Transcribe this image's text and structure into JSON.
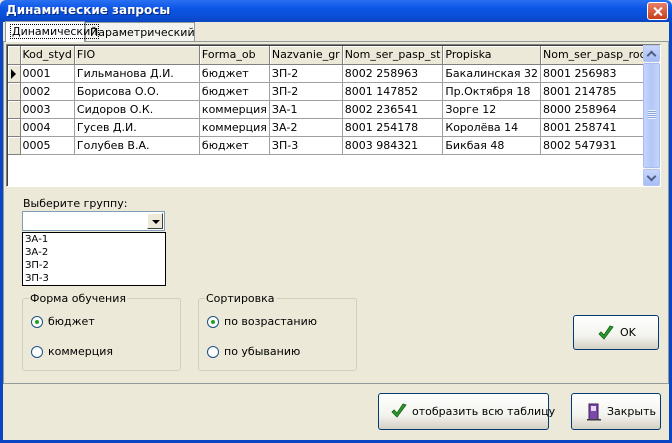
{
  "window": {
    "title": "Динамические запросы"
  },
  "tabs": [
    {
      "label": "Динамический",
      "active": true
    },
    {
      "label": "Параметрический",
      "active": false
    }
  ],
  "grid": {
    "columns": [
      "Kod_styd",
      "FIO",
      "Forma_ob",
      "Nazvanie_gr",
      "Nom_ser_pasp_st",
      "Propiska",
      "Nom_ser_pasp_rod"
    ],
    "rows": [
      [
        "0001",
        "Гильманова Д.И.",
        "бюджет",
        "ЗП-2",
        "8002 258963",
        "Бакалинская 32",
        "8001 256983"
      ],
      [
        "0002",
        "Борисова О.О.",
        "бюджет",
        "ЗП-2",
        "8001 147852",
        "Пр.Октября 18",
        "8001 214785"
      ],
      [
        "0003",
        "Сидоров О.К.",
        "коммерция",
        "ЗА-1",
        "8002 236541",
        "Зорге 12",
        "8000 258964"
      ],
      [
        "0004",
        "Гусев Д.И.",
        "коммерция",
        "ЗА-2",
        "8001 254178",
        "Королёва 14",
        "8001 258741"
      ],
      [
        "0005",
        "Голубев В.А.",
        "бюджет",
        "ЗП-3",
        "8003 984321",
        "Бикбая 48",
        "8002 547931"
      ]
    ],
    "current_row": 0
  },
  "group_select": {
    "label": "Выберите группу:",
    "value": "",
    "options": [
      "ЗА-1",
      "ЗА-2",
      "ЗП-2",
      "ЗП-3"
    ]
  },
  "form_group": {
    "title": "Форма обучения",
    "options": [
      {
        "label": "бюджет",
        "checked": true
      },
      {
        "label": "коммерция",
        "checked": false
      }
    ]
  },
  "sort_group": {
    "title": "Сортировка",
    "options": [
      {
        "label": "по возрастанию",
        "checked": true
      },
      {
        "label": "по убыванию",
        "checked": false
      }
    ]
  },
  "buttons": {
    "ok": "OK",
    "show_all": "отобразить всю таблицу",
    "close": "Закрыть"
  },
  "colors": {
    "titlebar": "#0a55e6",
    "check_icon": "#2a9a2a",
    "door_icon": "#7b4aa8"
  }
}
